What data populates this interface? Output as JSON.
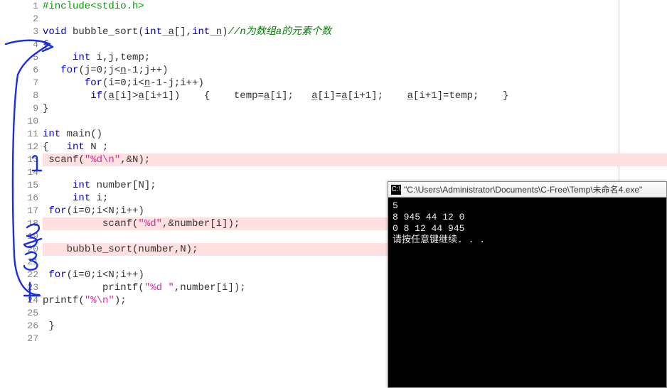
{
  "editor": {
    "lines": [
      {
        "n": 1,
        "hl": false
      },
      {
        "n": 2,
        "hl": false
      },
      {
        "n": 3,
        "hl": false
      },
      {
        "n": 4,
        "hl": false
      },
      {
        "n": 5,
        "hl": false
      },
      {
        "n": 6,
        "hl": false
      },
      {
        "n": 7,
        "hl": false
      },
      {
        "n": 8,
        "hl": false
      },
      {
        "n": 9,
        "hl": false
      },
      {
        "n": 10,
        "hl": false
      },
      {
        "n": 11,
        "hl": false
      },
      {
        "n": 12,
        "hl": false
      },
      {
        "n": 13,
        "hl": true
      },
      {
        "n": 14,
        "hl": false
      },
      {
        "n": 15,
        "hl": false
      },
      {
        "n": 16,
        "hl": false
      },
      {
        "n": 17,
        "hl": false
      },
      {
        "n": 18,
        "hl": true
      },
      {
        "n": 19,
        "hl": false
      },
      {
        "n": 20,
        "hl": true
      },
      {
        "n": 21,
        "hl": false
      },
      {
        "n": 22,
        "hl": false
      },
      {
        "n": 23,
        "hl": false
      },
      {
        "n": 24,
        "hl": false
      },
      {
        "n": 25,
        "hl": false
      },
      {
        "n": 26,
        "hl": false
      },
      {
        "n": 27,
        "hl": false
      }
    ]
  },
  "code": {
    "l1_pp": "#include<stdio.h>",
    "l3_void": "void",
    "l3_fn": " bubble_sort(",
    "l3_int1": "int",
    "l3_a": " a",
    "l3_arr": "[],",
    "l3_int2": "int",
    "l3_n": " n",
    "l3_close": ")",
    "l3_cmt": "//n为数组a的元素个数",
    "l4_open": "{",
    "l5_int": "int",
    "l5_decl": " i,j,temp;",
    "l6_for": "for",
    "l6_cond": "(j=0;j<",
    "l6_n": "n",
    "l6_cond2": "-1;j++)",
    "l7_for": "for",
    "l7_cond": "(i=0;i<",
    "l7_n": "n",
    "l7_cond2": "-1-j;i++)",
    "l8_if": "if",
    "l8_open": "(",
    "l8_a1": "a",
    "l8_a1b": "[i]>",
    "l8_a2": "a",
    "l8_a2b": "[i+1])",
    "l8_lb": "    {    ",
    "l8_temp1": "temp=",
    "l8_a3": "a",
    "l8_a3b": "[i];   ",
    "l8_a4": "a",
    "l8_a4b": "[i]=",
    "l8_a5": "a",
    "l8_a5b": "[i+1];    ",
    "l8_a6": "a",
    "l8_a6b": "[i+1]=temp;    }",
    "l9_close": "}",
    "l11_int": "int",
    "l11_main": " main()",
    "l12_open": "{   ",
    "l12_int": "int",
    "l12_n": " N ;",
    "l13_scanf": "scanf(",
    "l13_str": "\"%d\\n\"",
    "l13_rest": ",&N);",
    "l15_int": "int",
    "l15_decl": " number[N];",
    "l16_int": "int",
    "l16_decl": " i;",
    "l17_for": "for",
    "l17_cond": "(i=0;i<N;i++)",
    "l18_scanf": "scanf(",
    "l18_str": "\"%d\"",
    "l18_rest": ",&number[i]);",
    "l20_call": "bubble_sort(number,N);",
    "l22_for": "for",
    "l22_cond": "(i=0;i<N;i++)",
    "l23_printf": "printf(",
    "l23_str": "\"%d \"",
    "l23_rest": ",number[i]);",
    "l24_printf": "printf(",
    "l24_str": "\"%\\n\"",
    "l24_rest": ");",
    "l26_close": "}"
  },
  "console": {
    "title": "\"C:\\Users\\Administrator\\Documents\\C-Free\\Temp\\未命名4.exe\"",
    "icon_glyph": "C:\\",
    "out_line1": "5",
    "out_line2": "8 945 44 12 0",
    "out_line3": "0 8 12 44 945",
    "out_line4": "请按任意键继续. . ."
  }
}
